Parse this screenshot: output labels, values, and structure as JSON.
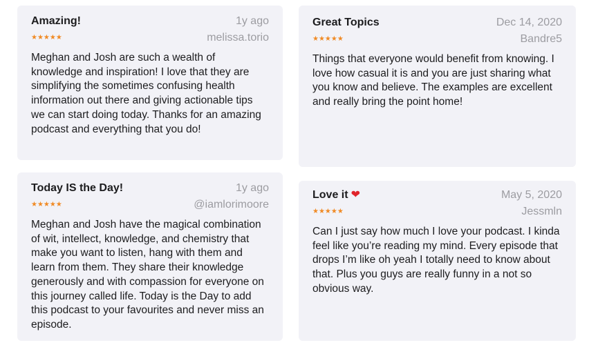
{
  "reviews": [
    {
      "title": "Amazing!",
      "date": "1y ago",
      "stars": "★★★★★",
      "author": "melissa.torio",
      "text": "Meghan and Josh are such a wealth of knowledge and inspiration! I love that they are simplifying the sometimes confusing health information out there and giving actionable tips we can start doing today. Thanks for an amazing podcast and everything that you do!"
    },
    {
      "title": "Great Topics",
      "date": "Dec 14, 2020",
      "stars": "★★★★★",
      "author": "Bandre5",
      "text": "Things that everyone would benefit from knowing. I love how casual it is and you are just sharing what you know and believe. The examples are excellent and really bring the point home!"
    },
    {
      "title": "Today IS the Day!",
      "date": "1y ago",
      "stars": "★★★★★",
      "author": "@iamlorimoore",
      "text": "Meghan and Josh have the magical combination of wit, intellect, knowledge, and chemistry that make you want to listen, hang with them and learn from them. They share their knowledge generously and with compassion for everyone on this journey called life. Today is the Day to add this podcast to your favourites and never miss an episode."
    },
    {
      "title": "Love it",
      "title_emoji": "❤",
      "date": "May 5, 2020",
      "stars": "★★★★★",
      "author": "Jessmln",
      "text": "Can I just say how much I love your podcast. I kinda feel like you’re reading my mind. Every episode that drops I’m like oh yeah I totally need to know about that. Plus you guys are really funny in a not so obvious way."
    }
  ],
  "star_rating": 5,
  "colors": {
    "card_background": "#f2f2f7",
    "stars": "#f08a24",
    "meta_text": "#9c9ca1",
    "heart": "#e0242b"
  }
}
